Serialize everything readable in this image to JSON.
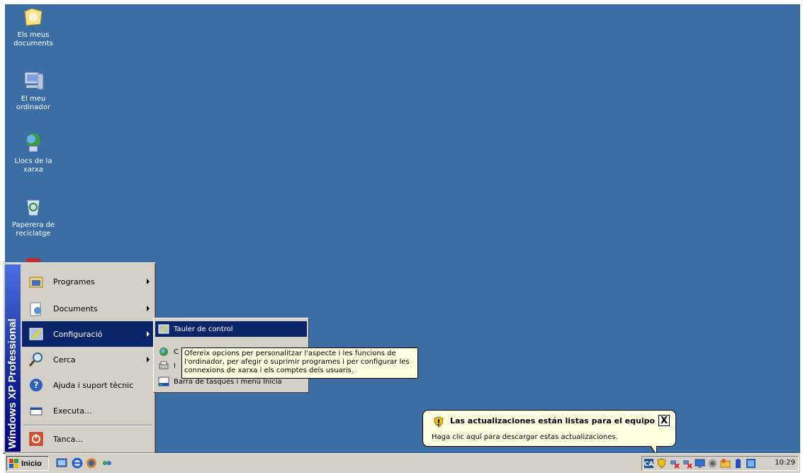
{
  "desktop": {
    "background": "#3a6ea5",
    "icons": [
      {
        "label": "Els meus documents",
        "icon": "my-documents-folder"
      },
      {
        "label": "El meu ordinador",
        "icon": "my-computer"
      },
      {
        "label": "Llocs de la xarxa",
        "icon": "network-places"
      },
      {
        "label": "Paperera de reciclatge",
        "icon": "recycle-bin"
      }
    ]
  },
  "start_menu": {
    "banner": "Windows XP Professional",
    "items": [
      {
        "label": "Programes",
        "icon": "programs-icon",
        "submenu": true
      },
      {
        "label": "Documents",
        "icon": "documents-icon",
        "submenu": true
      },
      {
        "label": "Configuració",
        "icon": "settings-icon",
        "submenu": true,
        "selected": true
      },
      {
        "label": "Cerca",
        "icon": "search-icon",
        "submenu": true
      },
      {
        "label": "Ajuda i suport tècnic",
        "icon": "help-icon",
        "submenu": false
      },
      {
        "label": "Executa...",
        "icon": "run-icon",
        "submenu": false
      },
      {
        "label": "Tanca...",
        "icon": "shutdown-icon",
        "submenu": false
      }
    ]
  },
  "submenu": {
    "items": [
      {
        "label": "Tauler de control",
        "icon": "control-panel-icon",
        "selected": true
      },
      {
        "label": "C",
        "icon": "network-connections-icon"
      },
      {
        "label": "I",
        "icon": "printers-icon"
      },
      {
        "label": "Barra de tasques i menú Inicia",
        "icon": "taskbar-icon"
      }
    ]
  },
  "tooltip": {
    "lines": [
      "Ofereix opcions per personalitzar l'aspecte i les funcions de",
      "l'ordinador, per afegir o suprimir programes i per configurar les",
      "connexions de xarxa i els comptes dels usuaris."
    ]
  },
  "balloon": {
    "title": "Las actualizaciones están listas para el equipo",
    "body": "Haga clic aquí para descargar estas actualizaciones.",
    "close": "X"
  },
  "taskbar": {
    "start_label": "Inicio",
    "clock": "10:29"
  }
}
